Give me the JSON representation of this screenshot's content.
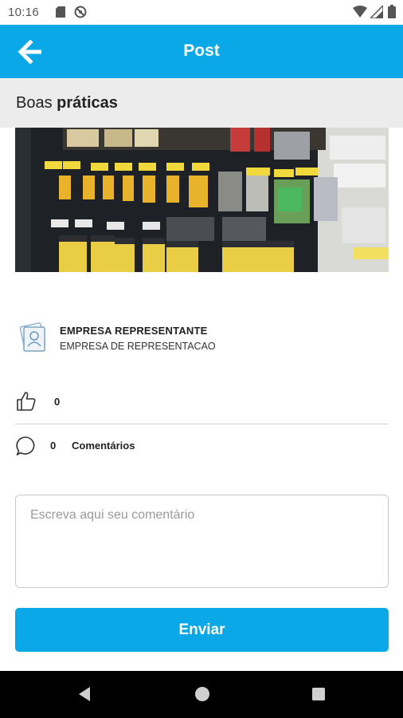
{
  "status_bar": {
    "time": "10:16",
    "icons": [
      "sd-card-icon",
      "do-not-disturb-icon",
      "wifi-icon",
      "signal-icon",
      "battery-icon"
    ]
  },
  "app_bar": {
    "title": "Post",
    "back_icon": "arrow-left-icon",
    "color": "#0aa8e6"
  },
  "section": {
    "title_regular": "Boas ",
    "title_bold": "práticas"
  },
  "post": {
    "image": "photo-of-paint-brushes-on-store-display"
  },
  "company": {
    "logo_icon": "company-logo-icon",
    "name": "EMPRESA REPRESENTANTE",
    "subtitle": "EMPRESA DE REPRESENTACAO"
  },
  "likes": {
    "icon": "thumbs-up-icon",
    "count": "0"
  },
  "comments": {
    "icon": "comment-bubble-icon",
    "count": "0",
    "label": "Comentários"
  },
  "comment_input": {
    "value": "",
    "placeholder": "Escreva aqui seu comentário"
  },
  "send_button": {
    "label": "Enviar"
  },
  "nav_bar": {
    "buttons": [
      "back-triangle-icon",
      "home-circle-icon",
      "recents-square-icon"
    ]
  }
}
